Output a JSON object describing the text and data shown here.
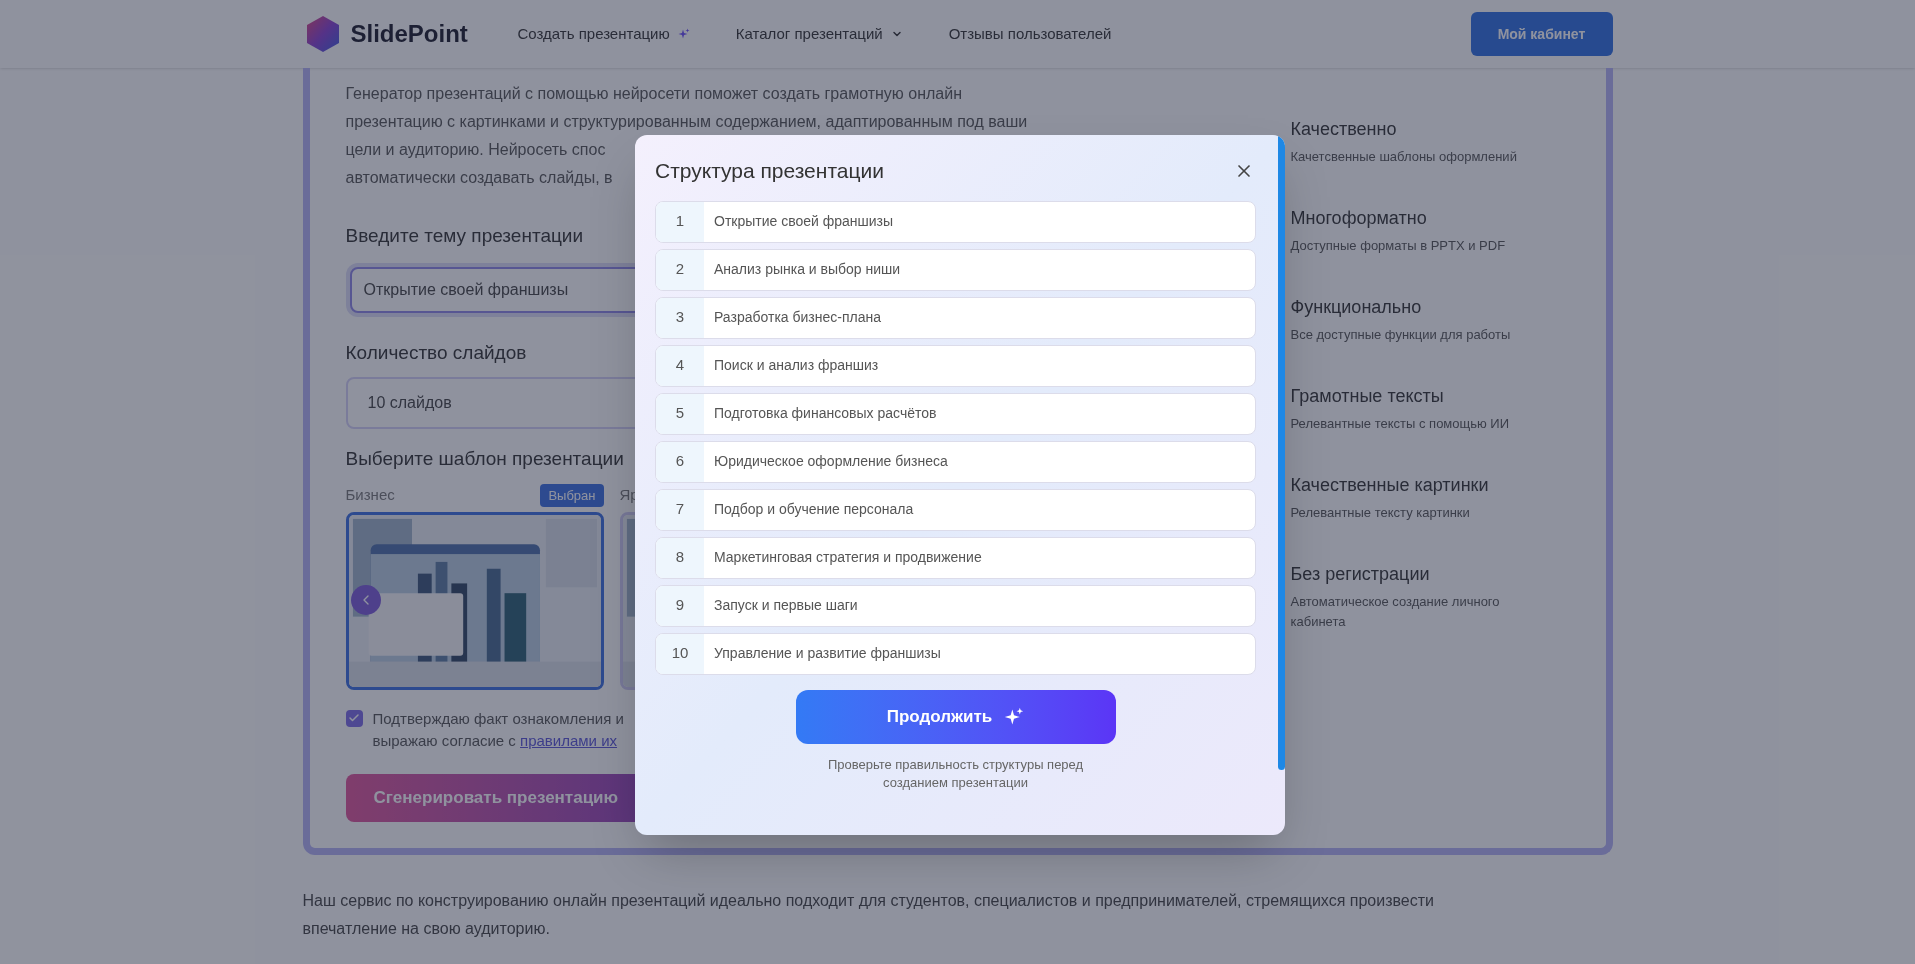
{
  "header": {
    "logo": "SlidePoint",
    "nav": [
      {
        "label": "Создать презентацию",
        "kind": "sparkle"
      },
      {
        "label": "Каталог презентаций",
        "kind": "dropdown"
      },
      {
        "label": "Отзывы пользователей",
        "kind": "plain"
      }
    ],
    "account_button": "Мой кабинет"
  },
  "form": {
    "intro_lines": [
      "Генератор презентаций с помощью нейросети поможет создать грамотную онлайн",
      "презентацию с картинками и структурированным содержанием, адаптированным под ваши",
      "цели и аудиторию. Нейросеть спос",
      "автоматически создавать слайды, в"
    ],
    "topic_label": "Введите тему презентации",
    "topic_value": "Открытие своей франшизы",
    "count_label": "Количество слайдов",
    "count_value": "10 слайдов",
    "template_label": "Выберите шаблон презентации",
    "templates": [
      {
        "name": "Бизнес",
        "badge": "Выбран",
        "selected": true,
        "kind": "picture"
      },
      {
        "name": "Яр",
        "selected": false,
        "kind": "picture"
      }
    ],
    "consent": {
      "checked": true,
      "line1": "Подтверждаю факт ознакомления и",
      "line2": "выражаю согласие с ",
      "link": "правилами их"
    },
    "generate_button": "Сгенерировать презентацию"
  },
  "features": [
    {
      "title": "Качественно",
      "subtitle": "Качетсвенные шаблоны оформлений"
    },
    {
      "title": "Многоформатно",
      "subtitle": "Доступные форматы в PPTX и PDF"
    },
    {
      "title": "Функционально",
      "subtitle": "Все доступные функции для работы"
    },
    {
      "title": "Грамотные тексты",
      "subtitle": "Релевантные тексты с помощью ИИ"
    },
    {
      "title": "Качественные картинки",
      "subtitle": "Релевантные тексту картинки"
    },
    {
      "title": "Без регистрации",
      "subtitle": "Автоматическое создание личного кабинета"
    }
  ],
  "footer_text": "Наш сервис по конструированию онлайн презентаций идеально подходит для студентов, специалистов и предпринимателей, стремящихся произвести впечатление на свою аудиторию.",
  "modal": {
    "title": "Структура презентации",
    "slides": [
      {
        "number": "1",
        "title": "Открытие своей франшизы"
      },
      {
        "number": "2",
        "title": "Анализ рынка и выбор ниши"
      },
      {
        "number": "3",
        "title": "Разработка бизнес-плана"
      },
      {
        "number": "4",
        "title": "Поиск и анализ франшиз"
      },
      {
        "number": "5",
        "title": "Подготовка финансовых расчётов"
      },
      {
        "number": "6",
        "title": "Юридическое оформление бизнеса"
      },
      {
        "number": "7",
        "title": "Подбор и обучение персонала"
      },
      {
        "number": "8",
        "title": "Маркетинговая стратегия и продвижение"
      },
      {
        "number": "9",
        "title": "Запуск и первые шаги"
      },
      {
        "number": "10",
        "title": "Управление и развитие франшизы"
      }
    ],
    "continue_button": "Продолжить",
    "hint": "Проверьте правильность структуры перед созданием презентации"
  }
}
